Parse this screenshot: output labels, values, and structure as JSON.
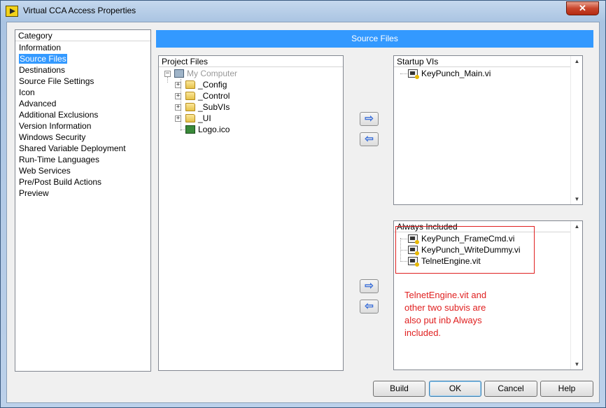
{
  "window": {
    "title": "Virtual CCA Access Properties",
    "close_glyph": "✕"
  },
  "category": {
    "header": "Category",
    "items": [
      "Information",
      "Source Files",
      "Destinations",
      "Source File Settings",
      "Icon",
      "Advanced",
      "Additional Exclusions",
      "Version Information",
      "Windows Security",
      "Shared Variable Deployment",
      "Run-Time Languages",
      "Web Services",
      "Pre/Post Build Actions",
      "Preview"
    ],
    "selected": "Source Files"
  },
  "banner": {
    "title": "Source Files"
  },
  "project_files": {
    "header": "Project Files",
    "root": {
      "label": "My Computer",
      "icon": "computer-icon"
    },
    "children": [
      {
        "label": "_Config",
        "icon": "folder-icon"
      },
      {
        "label": "_Control",
        "icon": "folder-icon"
      },
      {
        "label": "_SubVIs",
        "icon": "folder-icon"
      },
      {
        "label": "_UI",
        "icon": "folder-icon"
      },
      {
        "label": "Logo.ico",
        "icon": "image-icon"
      }
    ]
  },
  "startup_vis": {
    "header": "Startup VIs",
    "items": [
      "KeyPunch_Main.vi"
    ]
  },
  "always_included": {
    "header": "Always Included",
    "items": [
      "KeyPunch_FrameCmd.vi",
      "KeyPunch_WriteDummy.vi",
      "TelnetEngine.vit"
    ]
  },
  "annotation": {
    "lines": [
      "TelnetEngine.vit and",
      "other two subvis are",
      "also put inb Always",
      "included."
    ],
    "color": "#e02020"
  },
  "arrows": {
    "add_glyph": "⇨",
    "remove_glyph": "⇦"
  },
  "buttons": {
    "build": "Build",
    "ok": "OK",
    "cancel": "Cancel",
    "help": "Help"
  },
  "colors": {
    "selection": "#3399ff",
    "banner": "#3399ff"
  }
}
